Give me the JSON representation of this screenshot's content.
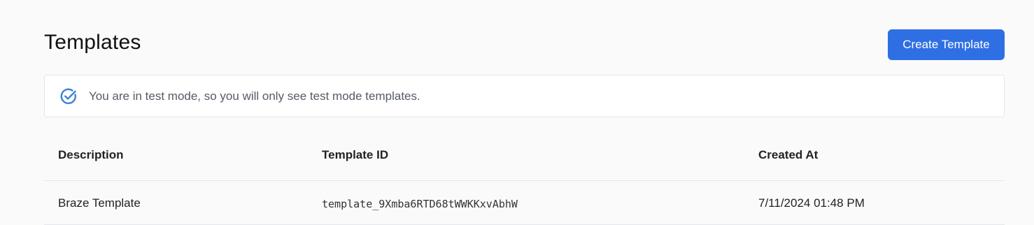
{
  "header": {
    "title": "Templates",
    "create_button_label": "Create Template"
  },
  "notice": {
    "icon": "check-circle-icon",
    "text": "You are in test mode, so you will only see test mode templates."
  },
  "table": {
    "columns": [
      "Description",
      "Template ID",
      "Created At"
    ],
    "rows": [
      {
        "description": "Braze Template",
        "template_id": "template_9Xmba6RTD68tWWKKxvAbhW",
        "created_at": "7/11/2024 01:48 PM"
      }
    ]
  },
  "colors": {
    "accent": "#2f6fe4",
    "notice_icon": "#3b82d6"
  }
}
